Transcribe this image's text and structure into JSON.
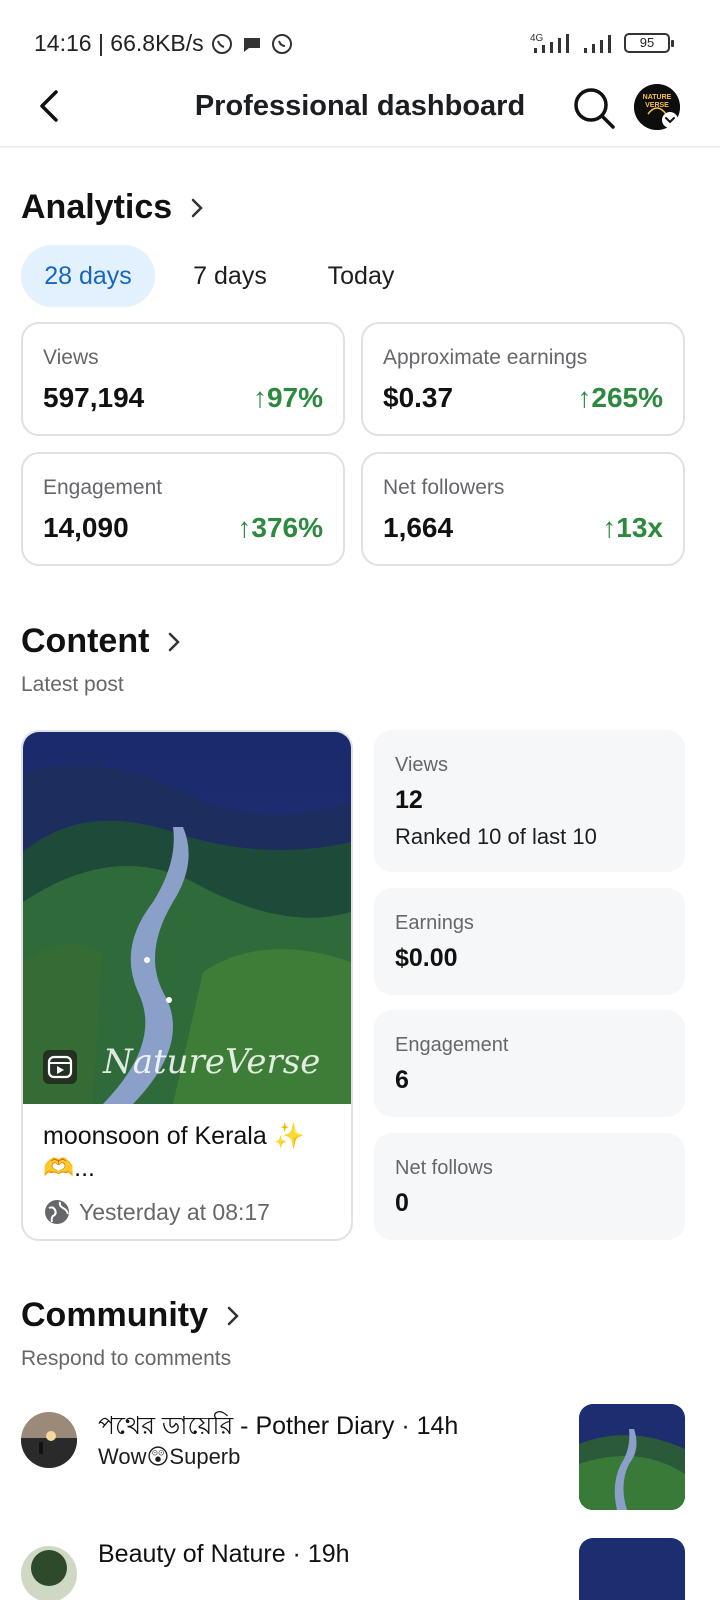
{
  "status_bar": {
    "time_speed": "14:16 | 66.8KB/s",
    "network": "4G",
    "battery": "95"
  },
  "header": {
    "title": "Professional dashboard",
    "avatar_text": "NATURE VERSE"
  },
  "analytics": {
    "title": "Analytics",
    "tabs": [
      {
        "label": "28 days",
        "active": true
      },
      {
        "label": "7 days",
        "active": false
      },
      {
        "label": "Today",
        "active": false
      }
    ],
    "metrics": [
      {
        "label": "Views",
        "value": "597,194",
        "change": "97%"
      },
      {
        "label": "Approximate earnings",
        "value": "$0.37",
        "change": "265%"
      },
      {
        "label": "Engagement",
        "value": "14,090",
        "change": "376%"
      },
      {
        "label": "Net followers",
        "value": "1,664",
        "change": "13x"
      }
    ],
    "up_color": "#2b8a3e"
  },
  "content": {
    "title": "Content",
    "subtitle": "Latest post",
    "post": {
      "watermark": "NatureVerse",
      "caption": "moonsoon of Kerala ✨🫶...",
      "time": "Yesterday at 08:17"
    },
    "stats": [
      {
        "label": "Views",
        "value": "12",
        "extra": "Ranked 10 of last 10"
      },
      {
        "label": "Earnings",
        "value": "$0.00"
      },
      {
        "label": "Engagement",
        "value": "6"
      },
      {
        "label": "Net follows",
        "value": "0"
      }
    ]
  },
  "community": {
    "title": "Community",
    "subtitle": "Respond to comments",
    "comments": [
      {
        "name": "পথের ডায়েরি - Pother Diary · 14h",
        "text": "Wow😲Superb"
      },
      {
        "name": "Beauty of Nature · 19h",
        "text": ""
      }
    ]
  },
  "colors": {
    "accent": "#1667c2",
    "accent_bg": "#e3f0fd",
    "positive": "#2b8a3e"
  }
}
